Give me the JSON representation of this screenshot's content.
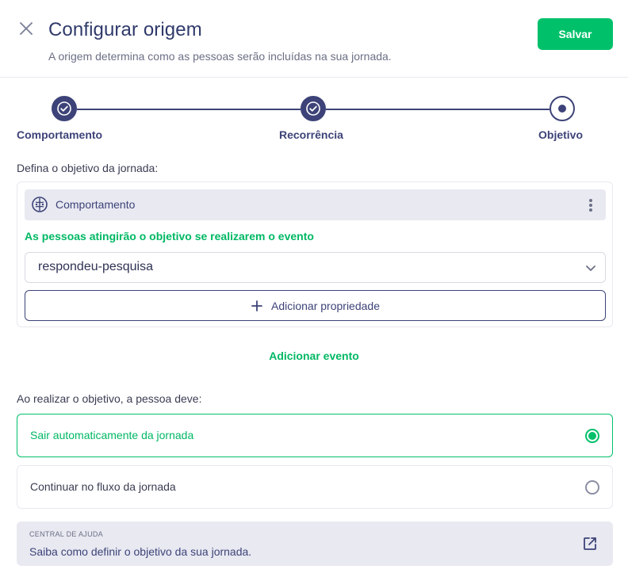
{
  "header": {
    "title": "Configurar origem",
    "subtitle": "A origem determina como as pessoas serão incluídas na sua jornada.",
    "save_label": "Salvar",
    "close_icon": "close-icon"
  },
  "stepper": {
    "steps": [
      {
        "label": "Comportamento",
        "state": "done",
        "icon": "check-icon"
      },
      {
        "label": "Recorrência",
        "state": "done",
        "icon": "check-icon"
      },
      {
        "label": "Objetivo",
        "state": "current",
        "icon": "dot-icon"
      }
    ]
  },
  "goal": {
    "section_label": "Defina o objetivo da jornada:",
    "event_card": {
      "type_label": "Comportamento",
      "type_icon": "brain-icon",
      "description": "As pessoas atingirão o objetivo se realizarem o evento",
      "selected_event": "respondeu-pesquisa",
      "add_property_label": "Adicionar propriedade"
    },
    "add_event_label": "Adicionar evento"
  },
  "exit": {
    "section_label": "Ao realizar o objetivo, a pessoa deve:",
    "options": [
      {
        "label": "Sair automaticamente da jornada",
        "selected": true
      },
      {
        "label": "Continuar no fluxo da jornada",
        "selected": false
      }
    ]
  },
  "help": {
    "caption": "CENTRAL DE AJUDA",
    "text": "Saiba como definir o objetivo da sua jornada."
  },
  "colors": {
    "primary": "#3d4378",
    "accent_green": "#00c16a",
    "muted_bg": "#e8e9f1"
  }
}
